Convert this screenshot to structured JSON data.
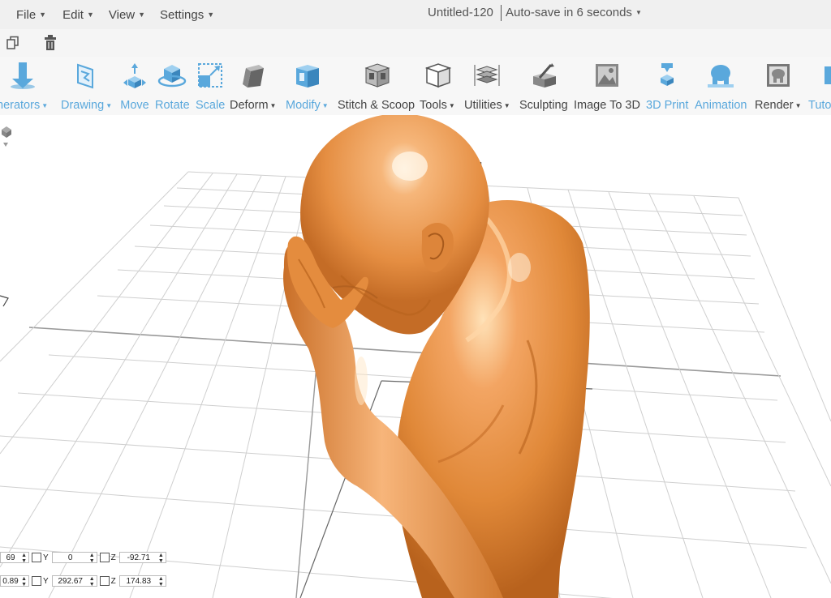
{
  "menu": [
    {
      "label": "File",
      "left": 0
    },
    {
      "label": "Edit"
    },
    {
      "label": "View"
    },
    {
      "label": "Settings"
    }
  ],
  "document": {
    "title": "Untitled-120",
    "autosave": "Auto-save in 6 seconds"
  },
  "toolbar": [
    {
      "label": "nerators",
      "color": "blue",
      "caret": true,
      "icon": "generators-icon"
    },
    {
      "label": "Drawing",
      "color": "blue",
      "caret": true,
      "icon": "drawing-icon"
    },
    {
      "label": "Move",
      "color": "blue",
      "caret": false,
      "icon": "move-icon"
    },
    {
      "label": "Rotate",
      "color": "blue",
      "caret": false,
      "icon": "rotate-icon"
    },
    {
      "label": "Scale",
      "color": "blue",
      "caret": false,
      "icon": "scale-icon"
    },
    {
      "label": "Deform",
      "color": "grey",
      "caret": true,
      "icon": "deform-icon"
    },
    {
      "label": "Modify",
      "color": "blue",
      "caret": true,
      "icon": "modify-icon"
    },
    {
      "label": "Stitch & Scoop",
      "color": "grey",
      "caret": false,
      "icon": "stitch-scoop-icon"
    },
    {
      "label": "Tools",
      "color": "grey",
      "caret": true,
      "icon": "tools-icon"
    },
    {
      "label": "Utilities",
      "color": "grey",
      "caret": true,
      "icon": "utilities-icon"
    },
    {
      "label": "Sculpting",
      "color": "grey",
      "caret": false,
      "icon": "sculpting-icon"
    },
    {
      "label": "Image To 3D",
      "color": "grey",
      "caret": false,
      "icon": "image-to-3d-icon"
    },
    {
      "label": "3D Print",
      "color": "blue",
      "caret": false,
      "icon": "3d-print-icon"
    },
    {
      "label": "Animation",
      "color": "blue",
      "caret": false,
      "icon": "animation-icon"
    },
    {
      "label": "Render",
      "color": "grey",
      "caret": true,
      "icon": "render-icon"
    },
    {
      "label": "Tuto",
      "color": "blue",
      "caret": false,
      "icon": "tutorials-icon"
    }
  ],
  "secondary_icons": [
    "copy-icon",
    "trash-icon"
  ],
  "coords": {
    "row1": {
      "x": "69",
      "y_label": "Y",
      "y": "0",
      "z_label": "Z",
      "z": "-92.71"
    },
    "row2": {
      "x": "0.89",
      "y_label": "Y",
      "y": "292.67",
      "z_label": "Z",
      "z": "174.83"
    }
  },
  "colors": {
    "accent": "#5aa8dc",
    "model": "#e8944a",
    "grid": "#c8c8c8"
  }
}
